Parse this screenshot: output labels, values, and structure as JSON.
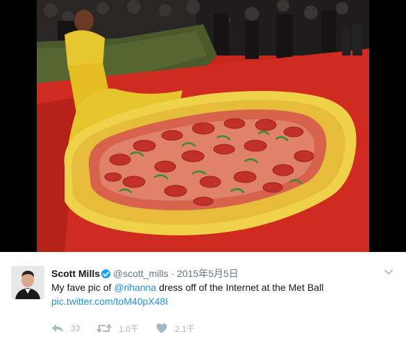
{
  "tweet": {
    "author_name": "Scott Mills",
    "handle": "@scott_mills",
    "separator": "·",
    "timestamp": "2015年5月5日",
    "text_before": "My fave pic of ",
    "mention": "@rihanna",
    "text_after": " dress off of the Internet at the Met Ball",
    "media_link": "pic.twitter.com/toM40pX48I",
    "reply_count": "33",
    "retweet_count": "1.0千",
    "like_count": "2.1千"
  },
  "colors": {
    "link": "#1b95e0",
    "verified": "#1da1f2",
    "muted": "#657786",
    "action_gray": "#aab8c2"
  },
  "icons": {
    "verified": "verified-badge-icon",
    "menu": "chevron-down-icon",
    "reply": "reply-icon",
    "retweet": "retweet-icon",
    "like": "heart-icon"
  }
}
